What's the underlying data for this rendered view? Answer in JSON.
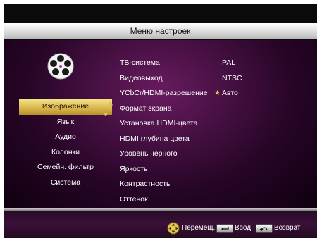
{
  "header": {
    "title": "Меню настроек"
  },
  "categories": {
    "items": [
      {
        "label": "Изображение",
        "selected": true
      },
      {
        "label": "Язык"
      },
      {
        "label": "Аудио"
      },
      {
        "label": "Колонки"
      },
      {
        "label": "Семейн. фильтр"
      },
      {
        "label": "Система"
      }
    ]
  },
  "options": {
    "rows": [
      {
        "label": "ТВ-система",
        "value": "PAL"
      },
      {
        "label": "Видеовыход",
        "value": "NTSC"
      },
      {
        "label": "YCbCr/HDMI-разрешение",
        "value": "Авто",
        "marked": "★"
      },
      {
        "label": "Формат экрана"
      },
      {
        "label": "Установка HDMI-цвета"
      },
      {
        "label": "HDMI глубина цвета"
      },
      {
        "label": "Уровень черного"
      },
      {
        "label": "Яркость"
      },
      {
        "label": "Контрастность"
      },
      {
        "label": "Оттенок"
      }
    ]
  },
  "footer": {
    "move_label": "Перемещ.",
    "enter_label": "Ввод",
    "return_label": "Возврат",
    "icons": [
      "dpad-icon",
      "enter-key-icon",
      "return-key-icon"
    ]
  },
  "colors": {
    "highlight": "#d8b44a",
    "panel": "#5a1456",
    "background": "#0a0a0a"
  }
}
